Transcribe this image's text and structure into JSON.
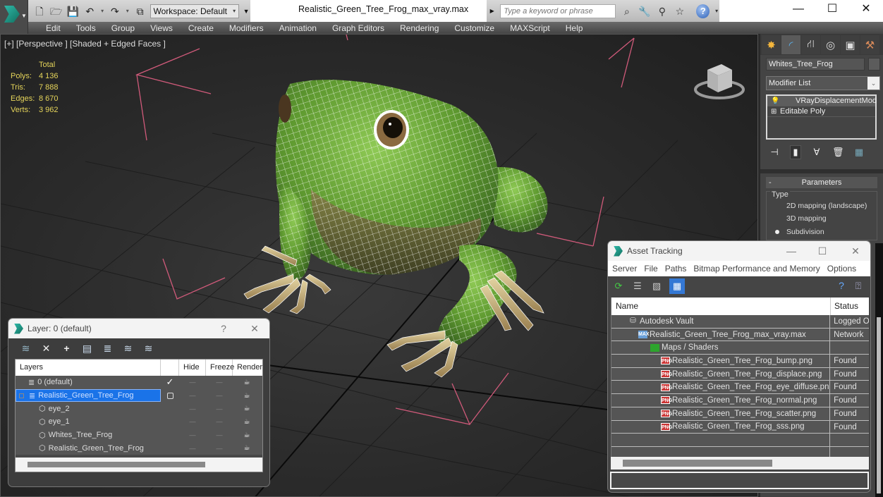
{
  "window": {
    "title": "Realistic_Green_Tree_Frog_max_vray.max",
    "workspace": "Workspace: Default",
    "search_placeholder": "Type a keyword or phrase",
    "controls": {
      "minimize": "—",
      "maximize": "☐",
      "close": "✕"
    }
  },
  "quick_access": {
    "icons": [
      "new-file-icon",
      "open-folder-icon",
      "save-icon",
      "undo-icon",
      "redo-icon",
      "project-folder-icon"
    ]
  },
  "menu": [
    "Edit",
    "Tools",
    "Group",
    "Views",
    "Create",
    "Modifiers",
    "Animation",
    "Graph Editors",
    "Rendering",
    "Customize",
    "MAXScript",
    "Help"
  ],
  "viewport": {
    "label": "[+] [Perspective ] [Shaded + Edged Faces ]",
    "stats": {
      "header": "Total",
      "rows": [
        {
          "label": "Polys:",
          "value": "4 136"
        },
        {
          "label": "Tris:",
          "value": "7 888"
        },
        {
          "label": "Edges:",
          "value": "8 670"
        },
        {
          "label": "Verts:",
          "value": "3 962"
        }
      ]
    },
    "object": "green tree frog mesh (shaded + edged faces)",
    "colors": {
      "frog_green": "#6fae3c",
      "wire": "#ffffff",
      "grid": "#1a1a1a",
      "selection_bracket": "#d05a7a",
      "stats_text": "#e5d45a"
    }
  },
  "command_panel": {
    "tabs": [
      "create-icon",
      "modify-icon",
      "hierarchy-icon",
      "motion-icon",
      "display-icon",
      "utilities-icon"
    ],
    "active_tab": 1,
    "object_name": "Whites_Tree_Frog",
    "modifier_list": "Modifier List",
    "stack": [
      {
        "label": "VRayDisplacementMod",
        "icon": "bulb-icon",
        "selected": true
      },
      {
        "label": "Editable Poly",
        "icon": "plus-box-icon",
        "selected": false
      }
    ],
    "parameters": {
      "title": "Parameters",
      "collapse": "-",
      "type_label": "Type",
      "options": [
        {
          "label": "2D mapping (landscape)",
          "checked": false
        },
        {
          "label": "3D mapping",
          "checked": false
        },
        {
          "label": "Subdivision",
          "checked": true
        }
      ]
    }
  },
  "layer_dialog": {
    "title": "Layer: 0 (default)",
    "help": "?",
    "close": "✕",
    "toolbar": [
      "new-layer-icon",
      "delete-layer-icon",
      "add-to-layer-icon",
      "select-objects-icon",
      "select-layer-icon",
      "highlight-layer-icon",
      "layer-settings-icon"
    ],
    "columns": [
      "Layers",
      "",
      "Hide",
      "Freeze",
      "Render"
    ],
    "rows": [
      {
        "name": "0 (default)",
        "type": "layer",
        "current": true,
        "selected": false,
        "indent": 0,
        "hide": "—",
        "freeze": "—"
      },
      {
        "name": "Realistic_Green_Tree_Frog",
        "type": "layer",
        "current": false,
        "selected": true,
        "indent": 0,
        "expander": "−",
        "hide": "—",
        "freeze": "—"
      },
      {
        "name": "eye_2",
        "type": "object",
        "indent": 1,
        "hide": "—",
        "freeze": "—"
      },
      {
        "name": "eye_1",
        "type": "object",
        "indent": 1,
        "hide": "—",
        "freeze": "—"
      },
      {
        "name": "Whites_Tree_Frog",
        "type": "object",
        "indent": 1,
        "hide": "—",
        "freeze": "—"
      },
      {
        "name": "Realistic_Green_Tree_Frog",
        "type": "object",
        "indent": 1,
        "hide": "—",
        "freeze": "—"
      }
    ]
  },
  "asset_dialog": {
    "title": "Asset Tracking",
    "controls": {
      "minimize": "—",
      "maximize": "☐",
      "close": "✕"
    },
    "menu": [
      "Server",
      "File",
      "Paths",
      "Bitmap Performance and Memory",
      "Options"
    ],
    "toolbar": [
      "refresh-icon",
      "list-view-icon",
      "thumbnail-view-icon",
      "table-view-icon"
    ],
    "columns": {
      "name": "Name",
      "status": "Status"
    },
    "rows": [
      {
        "name": "Autodesk Vault",
        "status": "Logged O",
        "icon": "vault",
        "indent": 1
      },
      {
        "name": "Realistic_Green_Tree_Frog_max_vray.max",
        "status": "Network",
        "icon": "max",
        "indent": 2
      },
      {
        "name": "Maps / Shaders",
        "status": "",
        "icon": "maps",
        "indent": 3
      },
      {
        "name": "Realistic_Green_Tree_Frog_bump.png",
        "status": "Found",
        "icon": "png",
        "indent": 4
      },
      {
        "name": "Realistic_Green_Tree_Frog_displace.png",
        "status": "Found",
        "icon": "png",
        "indent": 4
      },
      {
        "name": "Realistic_Green_Tree_Frog_eye_diffuse.png",
        "status": "Found",
        "icon": "png",
        "indent": 4
      },
      {
        "name": "Realistic_Green_Tree_Frog_normal.png",
        "status": "Found",
        "icon": "png",
        "indent": 4
      },
      {
        "name": "Realistic_Green_Tree_Frog_scatter.png",
        "status": "Found",
        "icon": "png",
        "indent": 4
      },
      {
        "name": "Realistic_Green_Tree_Frog_sss.png",
        "status": "Found",
        "icon": "png",
        "indent": 4
      },
      {
        "name": "",
        "status": "",
        "icon": "",
        "indent": 0
      },
      {
        "name": "",
        "status": "",
        "icon": "",
        "indent": 0
      }
    ]
  }
}
